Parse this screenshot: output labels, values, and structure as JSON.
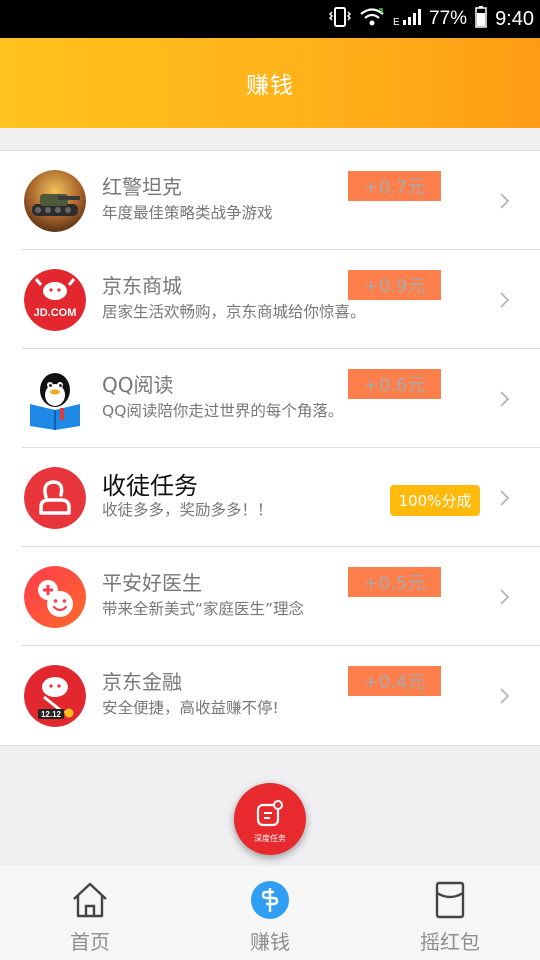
{
  "status_bar": {
    "network": "E",
    "battery": "77%",
    "time": "9:40"
  },
  "header": {
    "title": "赚钱"
  },
  "tasks": [
    {
      "icon": "tank-game-icon",
      "title": "红警坦克",
      "desc": "年度最佳策略类战争游戏",
      "reward": "+0.7元"
    },
    {
      "icon": "jd-mall-icon",
      "title": "京东商城",
      "desc": "居家生活欢畅购，京东商城给你惊喜。",
      "reward": "+0.9元",
      "logo_text": "JD.COM"
    },
    {
      "icon": "qq-reader-icon",
      "title": "QQ阅读",
      "desc": "QQ阅读陪你走过世界的每个角落。",
      "reward": "+0.6元"
    },
    {
      "icon": "recruit-user-icon",
      "title": "收徒任务",
      "desc": "收徒多多，奖励多多！！",
      "badge": "100%分成"
    },
    {
      "icon": "pingan-doctor-icon",
      "title": "平安好医生",
      "desc": "带来全新美式“家庭医生”理念",
      "reward": "+0.5元"
    },
    {
      "icon": "jd-finance-icon",
      "title": "京东金融",
      "desc": "安全便捷，高收益赚不停!",
      "reward": "+0.4元",
      "logo_text": "12.12"
    }
  ],
  "fab": {
    "label": "深度任务"
  },
  "tabbar": [
    {
      "label": "首页",
      "icon": "home-icon"
    },
    {
      "label": "赚钱",
      "icon": "money-icon",
      "active": true
    },
    {
      "label": "摇红包",
      "icon": "red-packet-icon"
    }
  ],
  "colors": {
    "header_start": "#ffc21e",
    "header_end": "#ff9c14",
    "reward_bg": "#fe7f4c",
    "badge_bg": "#ffba0b",
    "fab_bg": "#e8292e",
    "active_tab_icon": "#2f9ef4"
  }
}
